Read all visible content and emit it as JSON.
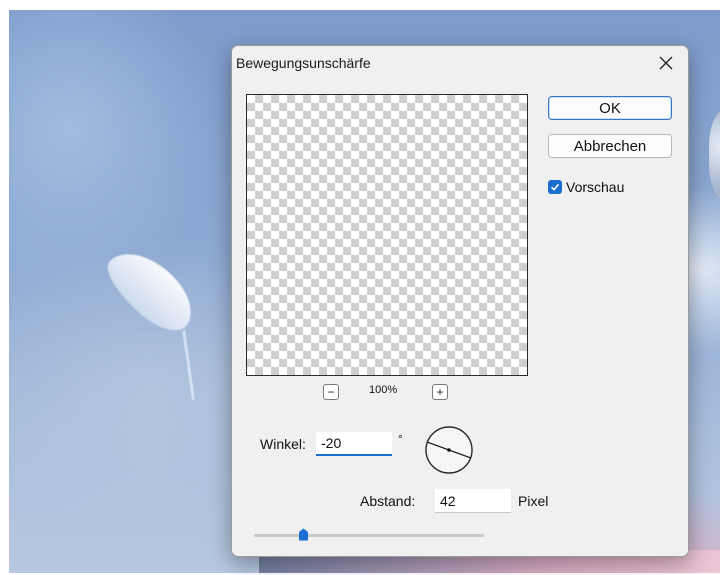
{
  "dialog": {
    "title": "Bewegungsunschärfe",
    "close_icon": "close-icon",
    "ok_label": "OK",
    "cancel_label": "Abbrechen",
    "preview_label": "Vorschau",
    "preview_checked": true,
    "zoom": {
      "minus_label": "−",
      "plus_label": "+",
      "value": "100%"
    },
    "angle": {
      "label": "Winkel:",
      "value": "-20",
      "unit": "°"
    },
    "distance": {
      "label": "Abstand:",
      "value": "42",
      "unit": "Pixel"
    },
    "slider_fraction": 0.21
  },
  "colors": {
    "accent": "#1b6fd0",
    "dialog_bg": "#f0f0f0"
  }
}
